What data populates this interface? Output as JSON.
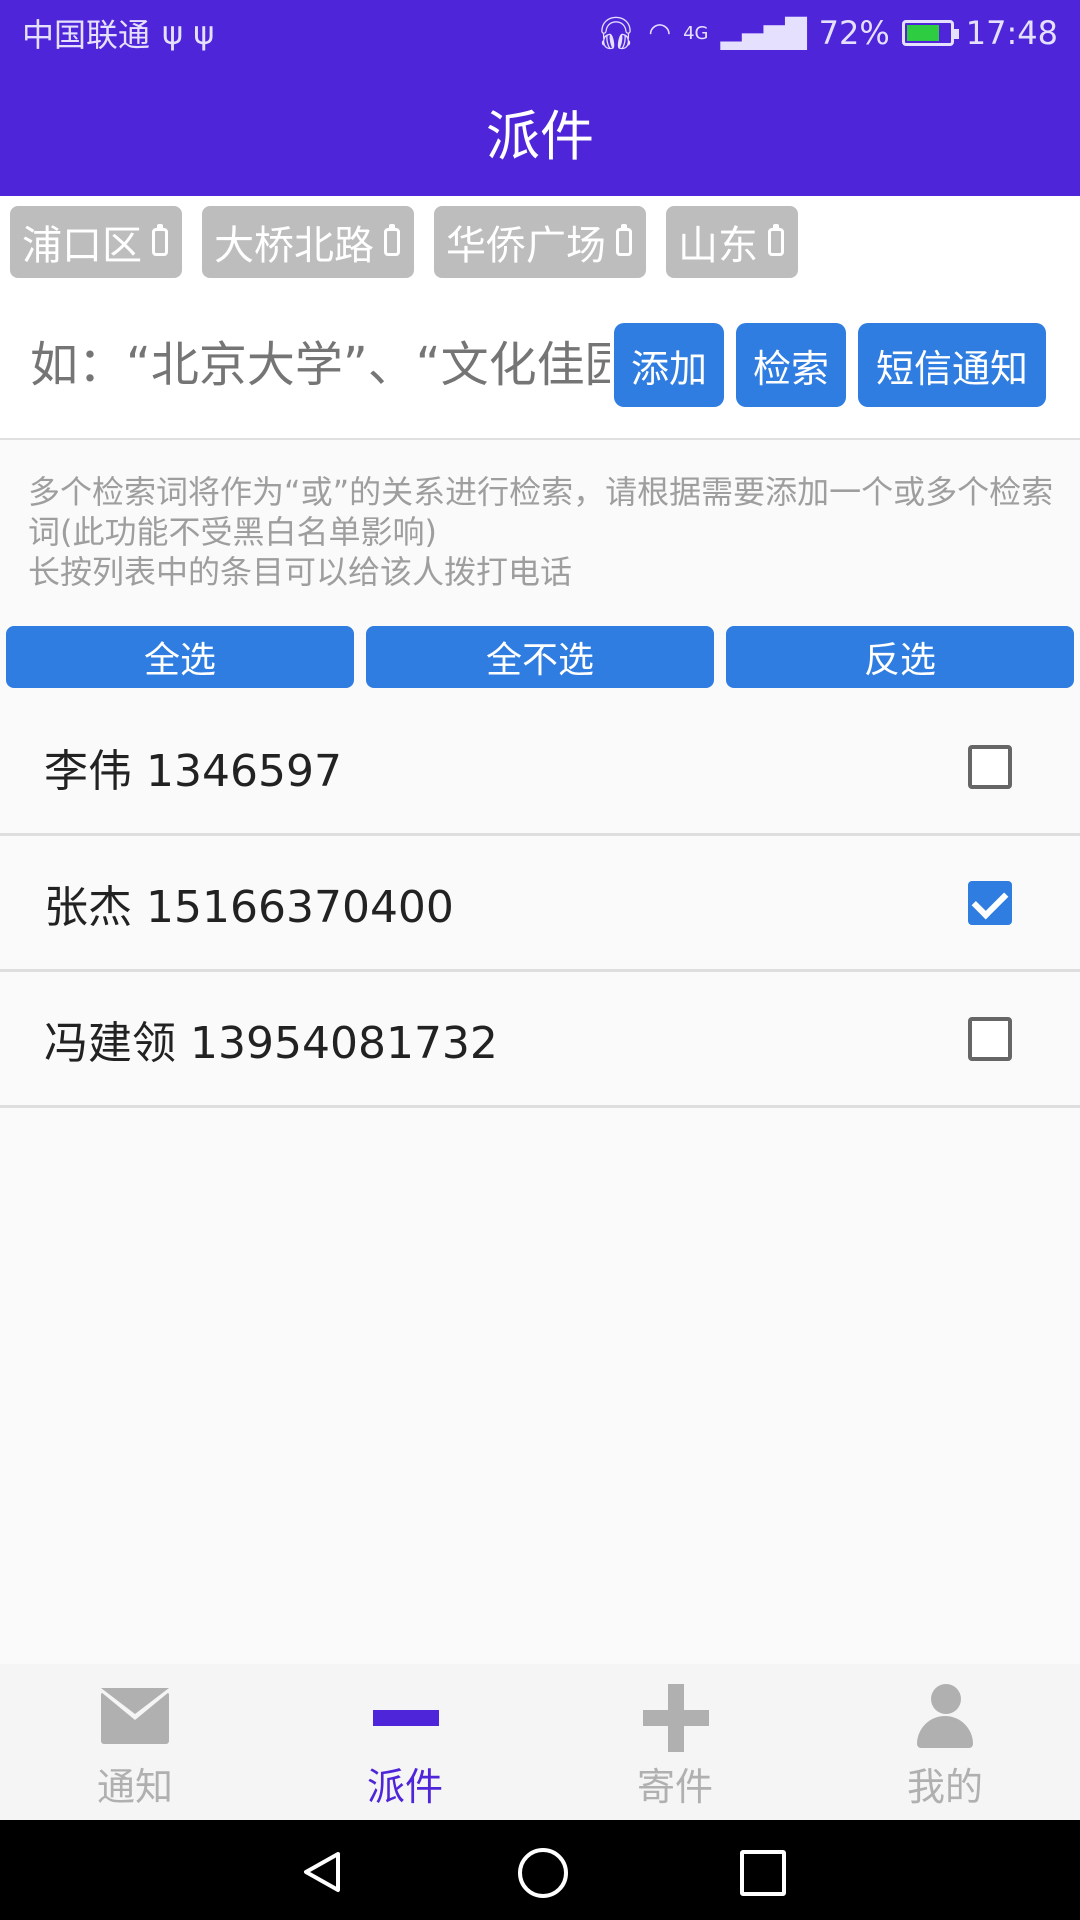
{
  "status_bar": {
    "carrier": "中国联通",
    "usb_icons": "ψ ψ",
    "network": "4G",
    "battery": "72%",
    "time": "17:48"
  },
  "app_bar": {
    "title": "派件"
  },
  "tags": [
    {
      "label": "浦口区"
    },
    {
      "label": "大桥北路"
    },
    {
      "label": "华侨广场"
    },
    {
      "label": "山东"
    }
  ],
  "search": {
    "placeholder": "如：“北京大学”、“文化佳园",
    "add_label": "添加",
    "search_label": "检索",
    "sms_label": "短信通知"
  },
  "hint": {
    "line1": "多个检索词将作为“或”的关系进行检索，请根据需要添加一个或多个检索词(此功能不受黑白名单影响)",
    "line2": "长按列表中的条目可以给该人拨打电话"
  },
  "selection": {
    "select_all": "全选",
    "select_none": "全不选",
    "invert": "反选"
  },
  "contacts": [
    {
      "label": "李伟 1346597",
      "checked": false
    },
    {
      "label": "张杰 15166370400",
      "checked": true
    },
    {
      "label": "冯建领 13954081732",
      "checked": false
    }
  ],
  "bottom_nav": [
    {
      "label": "通知",
      "icon": "envelope-icon",
      "active": false
    },
    {
      "label": "派件",
      "icon": "minus-icon",
      "active": true
    },
    {
      "label": "寄件",
      "icon": "plus-icon",
      "active": false
    },
    {
      "label": "我的",
      "icon": "person-icon",
      "active": false
    }
  ],
  "colors": {
    "brand": "#4f25d9",
    "button": "#2f7de1",
    "tag": "#bdbdbd"
  }
}
